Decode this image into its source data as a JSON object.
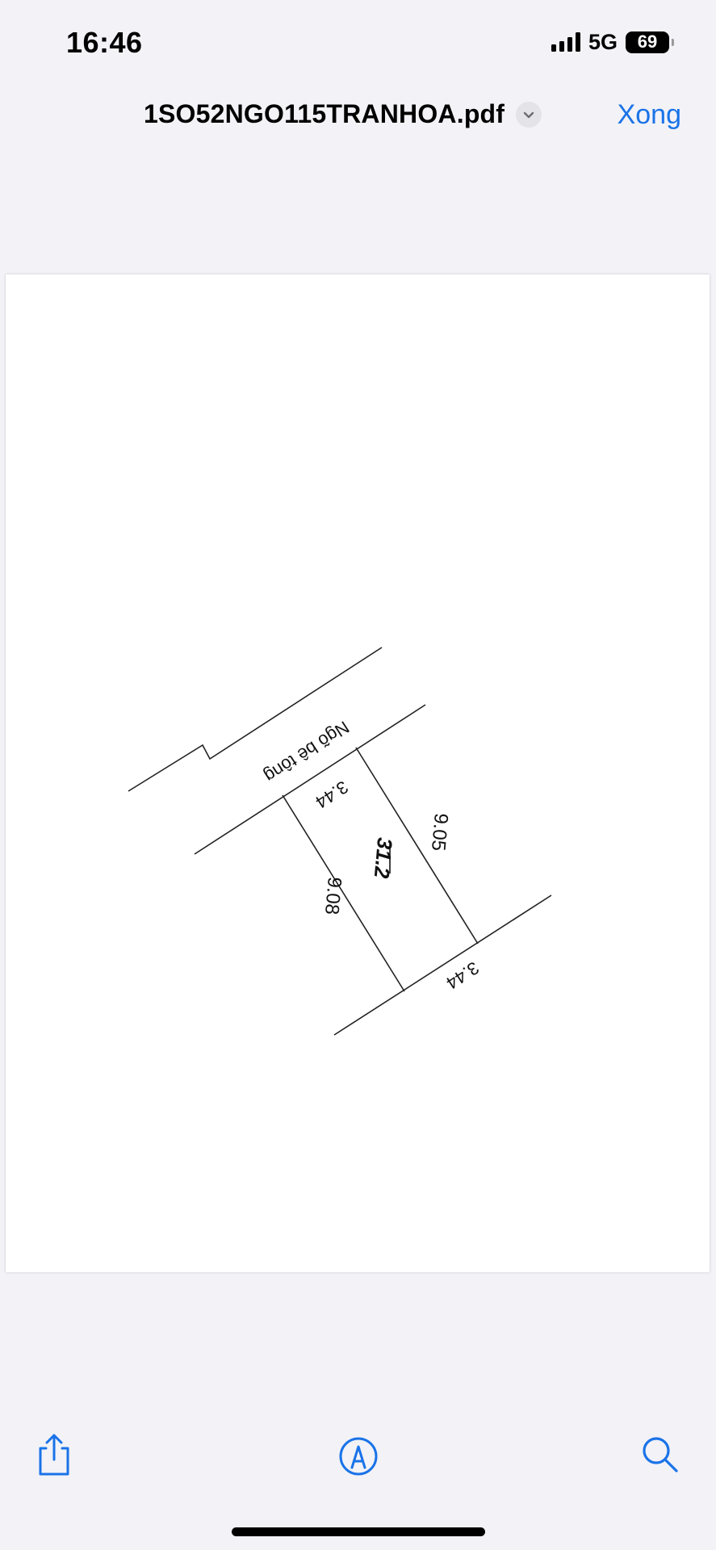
{
  "status_bar": {
    "time": "16:46",
    "network": "5G",
    "battery": "69"
  },
  "nav": {
    "title": "1SO52NGO115TRANHOA.pdf",
    "done_label": "Xong"
  },
  "plan": {
    "road_label": "Ngõ bê tông",
    "area": "31.2",
    "side_top": "3.44",
    "side_bottom": "3.44",
    "side_left": "9.08",
    "side_right": "9.05"
  },
  "icons": {
    "chevron": "chevron-down-icon",
    "share": "share-icon",
    "markup": "markup-pen-icon",
    "search": "search-icon"
  },
  "colors": {
    "accent": "#1a73e8",
    "icon_blue": "#1a73e8"
  }
}
